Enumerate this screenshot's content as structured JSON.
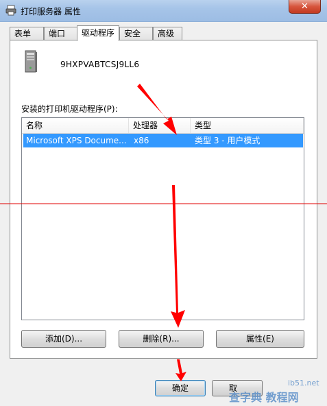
{
  "window": {
    "title": "打印服务器 属性",
    "close_glyph": "✕"
  },
  "tabs": [
    {
      "label": "表单",
      "active": false
    },
    {
      "label": "端口",
      "active": false
    },
    {
      "label": "驱动程序",
      "active": true
    },
    {
      "label": "安全",
      "active": false
    },
    {
      "label": "高级",
      "active": false
    }
  ],
  "server": {
    "name": "9HXPVABTCSJ9LL6",
    "icon": "server-tower-icon"
  },
  "drivers": {
    "label": "安装的打印机驱动程序(P):",
    "columns": [
      "名称",
      "处理器",
      "类型"
    ],
    "rows": [
      {
        "name": "Microsoft XPS Docume...",
        "processor": "x86",
        "type": "类型 3 - 用户模式",
        "selected": true
      }
    ]
  },
  "buttons": {
    "add": "添加(D)...",
    "remove": "删除(R)...",
    "properties": "属性(E)",
    "ok": "确定",
    "cancel": "取"
  },
  "colors": {
    "selection": "#3399ff",
    "annotation": "#ff0000",
    "close_button": "#c33a20"
  },
  "watermark": {
    "line1": "ib51.net",
    "line2": "查字典 教程网"
  }
}
